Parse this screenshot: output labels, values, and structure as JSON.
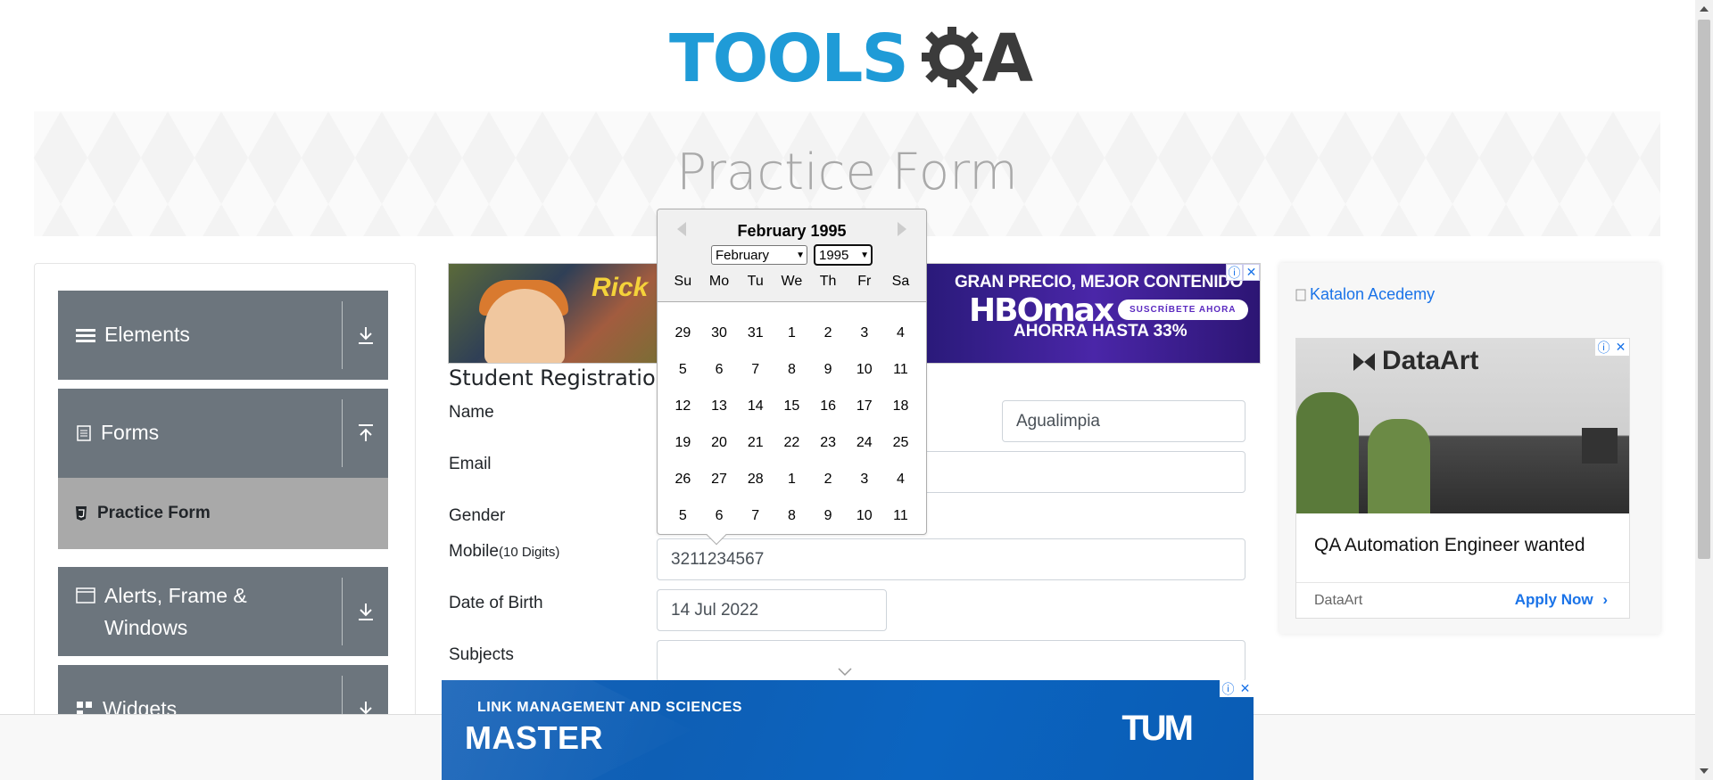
{
  "logo": {
    "tools": "TOOLS",
    "qa": "A"
  },
  "page": {
    "title": "Practice Form"
  },
  "sidebar": {
    "groups": [
      {
        "label": "Elements",
        "icon": "hamburger-icon",
        "arrow": "download-icon"
      },
      {
        "label": "Forms",
        "icon": "document-icon",
        "arrow": "upload-icon"
      },
      {
        "label": "Alerts, Frame &",
        "label2": "Windows",
        "icon": "window-icon",
        "arrow": "download-icon"
      },
      {
        "label": "Widgets",
        "icon": "widgets-icon",
        "arrow": "download-icon"
      }
    ],
    "active_item": {
      "label": "Practice Form",
      "icon": "html5-icon"
    }
  },
  "ad_top": {
    "cartoon_text": "Rick",
    "line1": "GRAN PRECIO, MEJOR CONTENIDO",
    "logo": "HBOmax",
    "button": "SUSCRÍBETE AHORA",
    "line3": "AHORRA HASTA 33%"
  },
  "form": {
    "heading": "Student Registration",
    "name_label": "Name",
    "last_name_value": "Agualimpia",
    "email_label": "Email",
    "gender_label": "Gender",
    "mobile_label": "Mobile",
    "mobile_hint": "(10 Digits)",
    "mobile_value": "3211234567",
    "dob_label": "Date of Birth",
    "dob_value": "14 Jul 2022",
    "subjects_label": "Subjects"
  },
  "datepicker": {
    "title": "February 1995",
    "month_select": "February",
    "year_select": "1995",
    "weekdays": [
      "Su",
      "Mo",
      "Tu",
      "We",
      "Th",
      "Fr",
      "Sa"
    ],
    "weeks": [
      [
        "29",
        "30",
        "31",
        "1",
        "2",
        "3",
        "4"
      ],
      [
        "5",
        "6",
        "7",
        "8",
        "9",
        "10",
        "11"
      ],
      [
        "12",
        "13",
        "14",
        "15",
        "16",
        "17",
        "18"
      ],
      [
        "19",
        "20",
        "21",
        "22",
        "23",
        "24",
        "25"
      ],
      [
        "26",
        "27",
        "28",
        "1",
        "2",
        "3",
        "4"
      ],
      [
        "5",
        "6",
        "7",
        "8",
        "9",
        "10",
        "11"
      ]
    ]
  },
  "ad_right": {
    "link_text": "Katalon Acedemy",
    "brand": "DataArt",
    "title": "QA Automation Engineer wanted",
    "advertiser": "DataArt",
    "cta": "Apply Now"
  },
  "ad_bottom": {
    "line1": "LINK MANAGEMENT AND SCIENCES",
    "line2": "MASTER",
    "logo": "TUM"
  },
  "colors": {
    "accent_blue": "#1f9bd7",
    "sidebar_group": "#6c757d",
    "sidebar_active": "#a9a9a9",
    "link_blue": "#1a73e8"
  }
}
